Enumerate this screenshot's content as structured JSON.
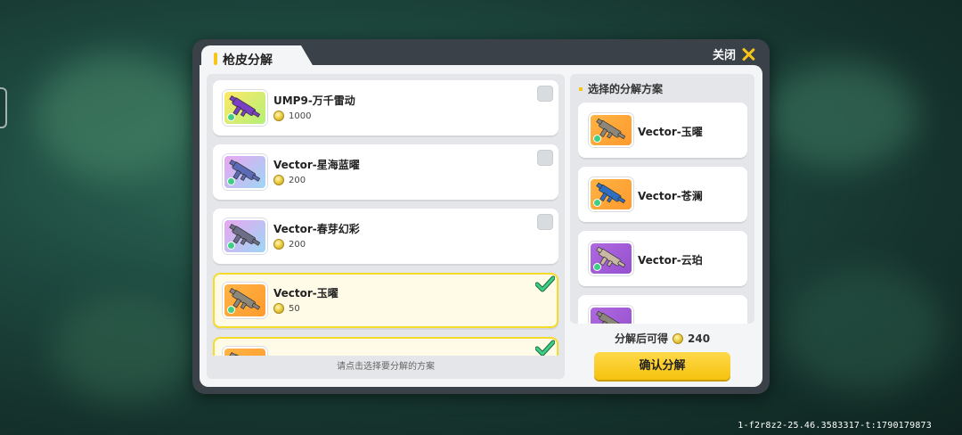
{
  "dialog": {
    "title": "枪皮分解",
    "close_label": "关闭"
  },
  "skin_list": {
    "items": [
      {
        "name": "UMP9-万千雷动",
        "price": "1000",
        "selected": false,
        "bg": "linear-gradient(135deg,#ffe866,#b3f07a)",
        "gun_color": "#7b3fc4"
      },
      {
        "name": "Vector-星海蓝曜",
        "price": "200",
        "selected": false,
        "bg": "linear-gradient(135deg,#e9a6f0,#9dd6f5)",
        "gun_color": "#5b6bb8"
      },
      {
        "name": "Vector-春芽幻彩",
        "price": "200",
        "selected": false,
        "bg": "linear-gradient(135deg,#e9a6f0,#9dd6f5)",
        "gun_color": "#6b6e86"
      },
      {
        "name": "Vector-玉曜",
        "price": "50",
        "selected": true,
        "bg": "linear-gradient(135deg,#ffb444,#ff9a2e)",
        "gun_color": "#8c8778"
      },
      {
        "name": "",
        "price": "",
        "selected": true,
        "bg": "linear-gradient(135deg,#ffb444,#ff9a2e)",
        "gun_color": "#8c8778"
      }
    ],
    "hint": "请点击选择要分解的方案"
  },
  "scheme_panel": {
    "title": "选择的分解方案",
    "items": [
      {
        "name": "Vector-玉曜",
        "bg": "linear-gradient(135deg,#ffb444,#ff9a2e)",
        "gun_color": "#8c8778"
      },
      {
        "name": "Vector-苍澜",
        "bg": "linear-gradient(135deg,#ffb444,#ff9a2e)",
        "gun_color": "#2f6fc2"
      },
      {
        "name": "Vector-云珀",
        "bg": "linear-gradient(135deg,#b06adf,#9450cf)",
        "gun_color": "#c9b9a2"
      },
      {
        "name": "",
        "bg": "linear-gradient(135deg,#b06adf,#9450cf)",
        "gun_color": "#8c8778"
      }
    ]
  },
  "summary": {
    "label": "分解后可得",
    "value": "240"
  },
  "confirm_label": "确认分解",
  "watermark": "1-f2r8z2-25.46.3583317-t:1790179873",
  "colors": {
    "accent": "#f5c518",
    "selected_border": "#f5dc2c",
    "modal_frame": "#3b4149",
    "check": "#3ecf84"
  }
}
